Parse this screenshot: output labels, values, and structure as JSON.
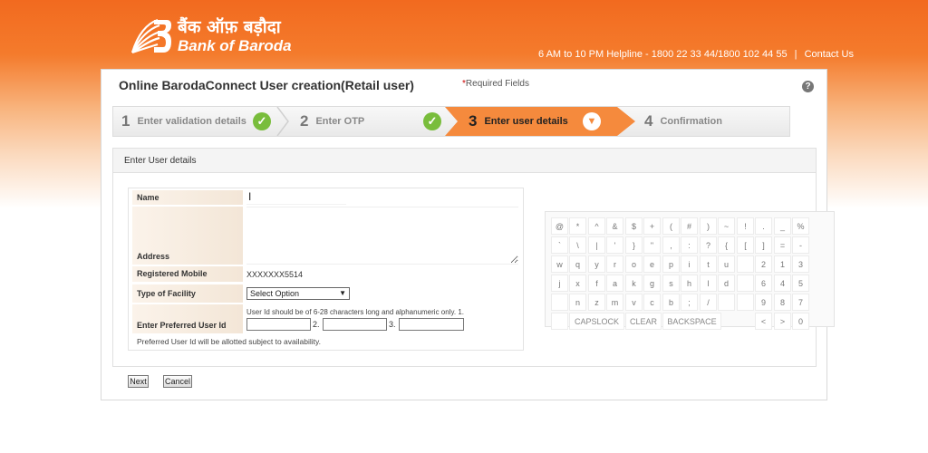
{
  "header": {
    "brand_hindi": "बैंक ऑफ़ बड़ौदा",
    "brand_english": "Bank of Baroda",
    "helpline": "6 AM to 10 PM Helpline - 1800 22 33 44/1800 102 44 55",
    "separator": "|",
    "contact_label": "Contact Us"
  },
  "page": {
    "title": "Online BarodaConnect User creation(Retail user)",
    "required_star": "*",
    "required_text": "Required Fields",
    "help_label": "?"
  },
  "steps": [
    {
      "num": "1",
      "label": "Enter validation details",
      "state": "done"
    },
    {
      "num": "2",
      "label": "Enter OTP",
      "state": "done"
    },
    {
      "num": "3",
      "label": "Enter user details",
      "state": "active"
    },
    {
      "num": "4",
      "label": "Confirmation",
      "state": "pending"
    }
  ],
  "icons": {
    "done": "✓",
    "active": "▼"
  },
  "form": {
    "section_title": "Enter User details",
    "name_label": "Name",
    "name_value": "",
    "cursor": "I",
    "address_label": "Address",
    "mobile_label": "Registered Mobile",
    "mobile_value": "XXXXXXX5514",
    "facility_label": "Type of Facility",
    "facility_selected": "Select Option",
    "facility_caret": "▼",
    "userid_label": "Enter Preferred User Id",
    "userid_hint": "User Id should be of 6-28 characters long and alphanumeric only. 1.",
    "userid_num2": "2.",
    "userid_num3": "3.",
    "footnote": "Preferred User Id will be allotted subject to availability."
  },
  "keyboard": {
    "rows": [
      [
        "@",
        "*",
        "^",
        "&",
        "$",
        "+",
        "(",
        "#",
        ")",
        "~",
        "!",
        ".",
        "_",
        "%"
      ],
      [
        "`",
        "\\",
        "|",
        "'",
        "}",
        "\"",
        ",",
        ":",
        "?",
        "{",
        "[",
        "]",
        "=",
        "-"
      ],
      [
        "w",
        "q",
        "y",
        "r",
        "o",
        "e",
        "p",
        "i",
        "t",
        "u",
        "",
        "2",
        "1",
        "3"
      ],
      [
        "j",
        "x",
        "f",
        "a",
        "k",
        "g",
        "s",
        "h",
        "l",
        "d",
        "",
        "6",
        "4",
        "5"
      ],
      [
        "",
        "n",
        "z",
        "m",
        "v",
        "c",
        "b",
        ";",
        "/",
        "",
        "",
        "9",
        "8",
        "7"
      ]
    ],
    "capslock": "CAPSLOCK",
    "clear": "CLEAR",
    "backspace": "BACKSPACE",
    "last_keys": [
      "<",
      ">",
      "0"
    ]
  },
  "buttons": {
    "next": "Next",
    "cancel": "Cancel"
  },
  "colors": {
    "brand_orange": "#f26a1f",
    "active_step": "#f58a3d",
    "check_green": "#79bd3c"
  }
}
